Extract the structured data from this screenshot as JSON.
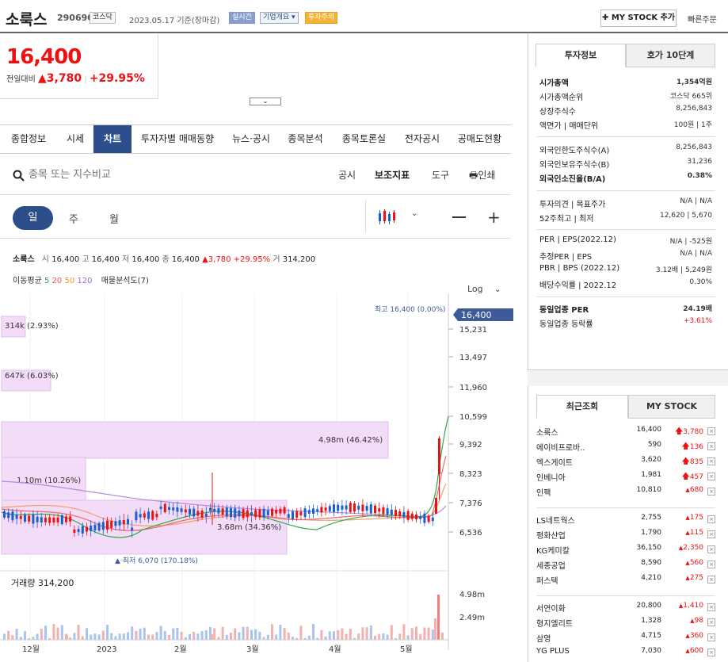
{
  "header": {
    "name": "소룩스",
    "code": "290690",
    "market": "코스닥",
    "date": "2023.05.17 기준(장마감)",
    "badge_realtime": "실시간",
    "badge_company": "기업개요 ▾",
    "badge_warning": "투자주의",
    "mystock": "✚ MY STOCK 추가",
    "quick_order": "빠른주문"
  },
  "price": {
    "current": "16,400",
    "label": "전일대비",
    "arrow": "▲",
    "change": "3,780",
    "pct": "+29.95%"
  },
  "tabs": [
    "종합정보",
    "시세",
    "차트",
    "투자자별 매매동향",
    "뉴스·공시",
    "종목분석",
    "종목토론실",
    "전자공시",
    "공매도현황"
  ],
  "search": {
    "placeholder": "종목 또는 지수비교",
    "links": [
      "공시",
      "보조지표",
      "도구"
    ],
    "print": "인쇄"
  },
  "periods": [
    "일",
    "주",
    "월"
  ],
  "quote": {
    "name": "소룩스",
    "open_l": "시",
    "open": "16,400",
    "high_l": "고",
    "high": "16,400",
    "low_l": "저",
    "low": "16,400",
    "close_l": "종",
    "close": "16,400",
    "chg": "▲3,780 +29.95%",
    "vol_l": "거",
    "vol": "314,200"
  },
  "ma": {
    "label": "이동평균",
    "p5": "5",
    "p20": "20",
    "p50": "50",
    "p120": "120",
    "extra": "매물분석도(7)"
  },
  "chart": {
    "log": "Log",
    "max_label": "최고 16,400 (0.00%)",
    "min_label": "▲ 최저 6,070 (170.18%)",
    "volume_label": "거래량 314,200",
    "price_tag": "16,400",
    "y_ticks": [
      "15,231",
      "13,497",
      "11,960",
      "10,599",
      "9,392",
      "8,323",
      "7,376",
      "6,536"
    ],
    "vol_ticks": [
      "4.98m",
      "2.49m"
    ],
    "x_ticks": [
      "12월",
      "2023",
      "2월",
      "3월",
      "4월",
      "5월"
    ],
    "profile": [
      "314k (2.93%)",
      "647k (6.03%)",
      "4.98m (46.42%)",
      "1.10m (10.26%)",
      "3.68m (34.36%)"
    ]
  },
  "side": {
    "tabs": [
      "투자정보",
      "호가 10단계"
    ],
    "rows": [
      {
        "k": "시가총액",
        "v": "1,354억원",
        "bold": true
      },
      {
        "k": "시가총액순위",
        "v": "코스닥 665위"
      },
      {
        "k": "상장주식수",
        "v": "8,256,843"
      },
      {
        "k": "액면가 | 매매단위",
        "v": "100원 | 1주"
      },
      {
        "k": "외국인한도주식수(A)",
        "v": "8,256,843"
      },
      {
        "k": "외국인보유주식수(B)",
        "v": "31,236"
      },
      {
        "k": "외국인소진율(B/A)",
        "v": "0.38%",
        "bold": true
      },
      {
        "k": "투자의견 | 목표주가",
        "v": "N/A | N/A"
      },
      {
        "k": "52주최고 | 최저",
        "v": "12,620 | 5,670"
      },
      {
        "k": "PER | EPS(2022.12)",
        "v": "N/A | -525원"
      },
      {
        "k": "추정PER | EPS",
        "v": "N/A | N/A"
      },
      {
        "k": "PBR | BPS (2022.12)",
        "v": "3.12배 | 5,249원"
      },
      {
        "k": "배당수익률 | 2022.12",
        "v": "0.30%"
      },
      {
        "k": "동일업종 PER",
        "v": "24.19배",
        "bold": true
      },
      {
        "k": "동일업종 등락률",
        "v": "+3.61%",
        "red": true
      }
    ]
  },
  "recent": {
    "tabs": [
      "최근조회",
      "MY STOCK"
    ],
    "items": [
      {
        "n": "소룩스",
        "p": "16,400",
        "c": "3,780",
        "up": "big"
      },
      {
        "n": "에이비프로바..",
        "p": "590",
        "c": "136",
        "up": "big"
      },
      {
        "n": "엑스게이트",
        "p": "3,620",
        "c": "835",
        "up": "big"
      },
      {
        "n": "인베니아",
        "p": "1,981",
        "c": "457",
        "up": "big"
      },
      {
        "n": "인팩",
        "p": "10,810",
        "c": "680",
        "up": "small"
      },
      {
        "n": "LS네트웍스",
        "p": "2,755",
        "c": "175",
        "up": "small"
      },
      {
        "n": "평화산업",
        "p": "1,790",
        "c": "115",
        "up": "small"
      },
      {
        "n": "KG케미칼",
        "p": "36,150",
        "c": "2,350",
        "up": "small"
      },
      {
        "n": "세종공업",
        "p": "8,590",
        "c": "560",
        "up": "small"
      },
      {
        "n": "퍼스텍",
        "p": "4,210",
        "c": "275",
        "up": "small"
      },
      {
        "n": "서연이화",
        "p": "20,800",
        "c": "1,410",
        "up": "small"
      },
      {
        "n": "형지엘리트",
        "p": "1,328",
        "c": "98",
        "up": "small"
      },
      {
        "n": "삼영",
        "p": "4,715",
        "c": "360",
        "up": "small"
      },
      {
        "n": "YG PLUS",
        "p": "7,030",
        "c": "600",
        "up": "small"
      }
    ]
  },
  "colors": {
    "up": "#e11",
    "down": "#1a5fd0",
    "accent": "#2c4e8a",
    "profile": "#f0d8f5"
  }
}
